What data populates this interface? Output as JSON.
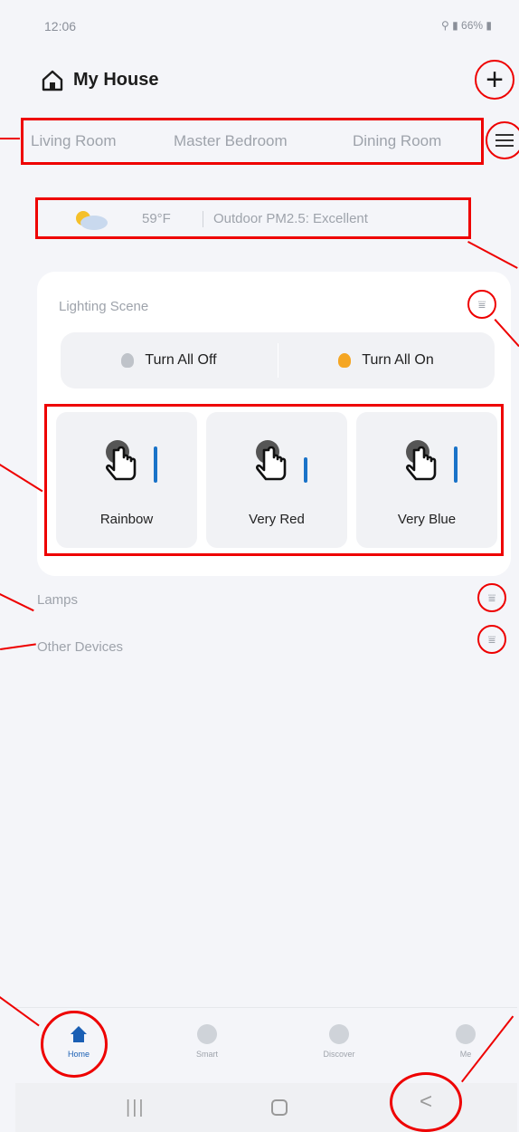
{
  "status": {
    "time": "12:06",
    "indicators": "⚲ ▮ 66% ▮",
    "battery": "66%"
  },
  "header": {
    "title": "My House",
    "add_label": "+"
  },
  "tabs": [
    {
      "label": "Living Room"
    },
    {
      "label": "Master Bedroom"
    },
    {
      "label": "Dining Room"
    }
  ],
  "weather": {
    "temperature": "59°F",
    "pm_text": "Outdoor PM2.5: Excellent"
  },
  "lighting": {
    "title": "Lighting Scene",
    "turn_all_off": "Turn All Off",
    "turn_all_on": "Turn All On",
    "scenes": [
      {
        "label": "Rainbow"
      },
      {
        "label": "Very Red"
      },
      {
        "label": "Very Blue"
      }
    ]
  },
  "sections": {
    "lamps": "Lamps",
    "other_devices": "Other Devices"
  },
  "bottom_nav": [
    {
      "label": "Home",
      "icon": "home-icon",
      "active": true
    },
    {
      "label": "Smart",
      "icon": "smart-icon",
      "active": false
    },
    {
      "label": "Discover",
      "icon": "discover-icon",
      "active": false
    },
    {
      "label": "Me",
      "icon": "profile-icon",
      "active": false
    }
  ],
  "system_nav": {
    "recent": "|||",
    "back": "<"
  },
  "colors": {
    "accent": "#1a5fb4",
    "annotation": "#e00000",
    "bulb_on": "#f5a623",
    "bulb_off": "#bfc3c9",
    "background": "#f4f5f9"
  }
}
